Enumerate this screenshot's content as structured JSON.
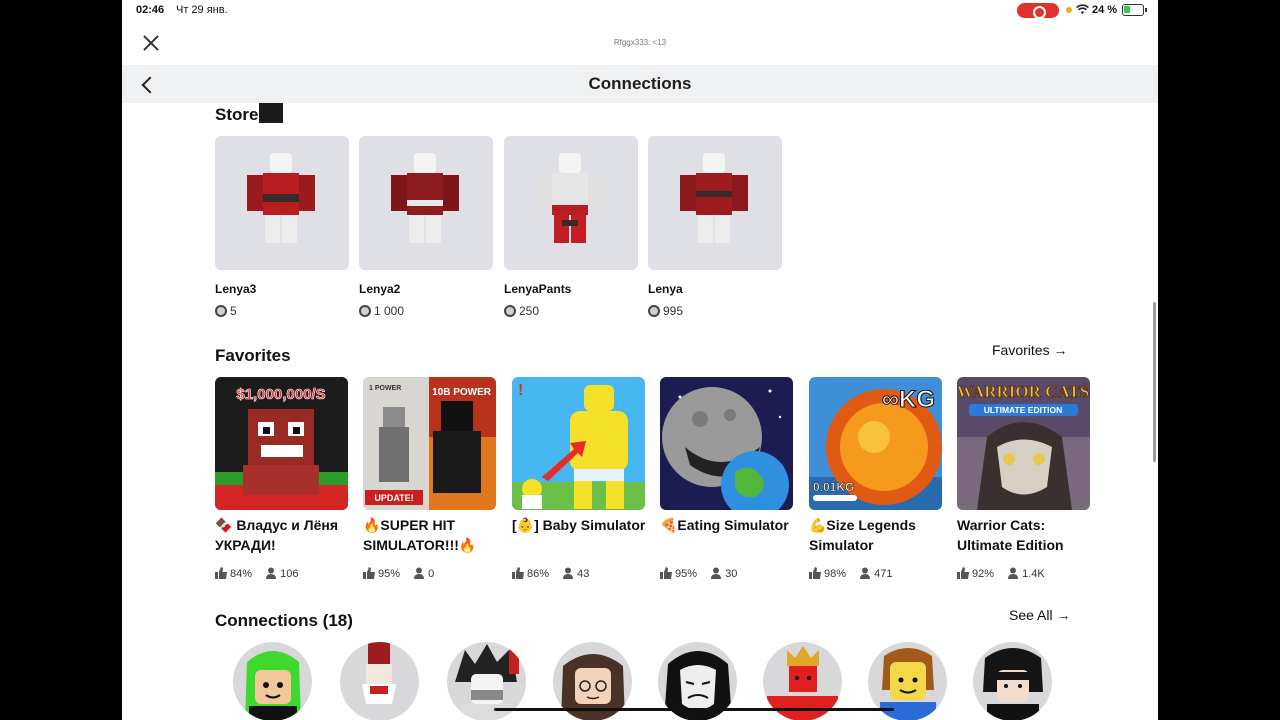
{
  "status_bar": {
    "time": "02:46",
    "date": "Чт 29 янв.",
    "battery": "24 %"
  },
  "browser": {
    "url_label": "Rfggx333: <13"
  },
  "header": {
    "title": "Connections"
  },
  "store": {
    "title": "Store",
    "items": [
      {
        "name": "Lenya3",
        "price": "5"
      },
      {
        "name": "Lenya2",
        "price": "1 000"
      },
      {
        "name": "LenyaPants",
        "price": "250"
      },
      {
        "name": "Lenya",
        "price": "995"
      }
    ]
  },
  "favorites": {
    "title": "Favorites",
    "link": "Favorites →",
    "games": [
      {
        "title": "🍫 Владус и Лёня УКРАДИ!",
        "rating": "84%",
        "players": "106",
        "banner": "$1,000,000/S"
      },
      {
        "title": "🔥SUPER HIT SIMULATOR!!!🔥",
        "rating": "95%",
        "players": "0",
        "banner": "10B POWER",
        "badge": "UPDATE!",
        "small": "1 POWER"
      },
      {
        "title": "[👶] Baby Simulator",
        "rating": "86%",
        "players": "43",
        "banner": "!"
      },
      {
        "title": "🍕Eating Simulator",
        "rating": "95%",
        "players": "30"
      },
      {
        "title": "💪Size Legends Simulator",
        "rating": "98%",
        "players": "471",
        "banner": "∞KG",
        "small": "0.01KG"
      },
      {
        "title": "Warrior Cats: Ultimate Edition",
        "rating": "92%",
        "players": "1.4K",
        "banner": "WARRIOR CATS",
        "small": "ULTIMATE EDITION"
      }
    ]
  },
  "connections": {
    "title": "Connections (18)",
    "link": "See All →",
    "avatars": [
      "green-hood",
      "red-bow",
      "spiky-hair",
      "brown-hair",
      "hacker-mask",
      "crown",
      "noob",
      "black-hair"
    ]
  },
  "colors": {
    "status_record": "#e0322b",
    "battery": "#34c759",
    "header_bg": "#f0f1f2"
  }
}
